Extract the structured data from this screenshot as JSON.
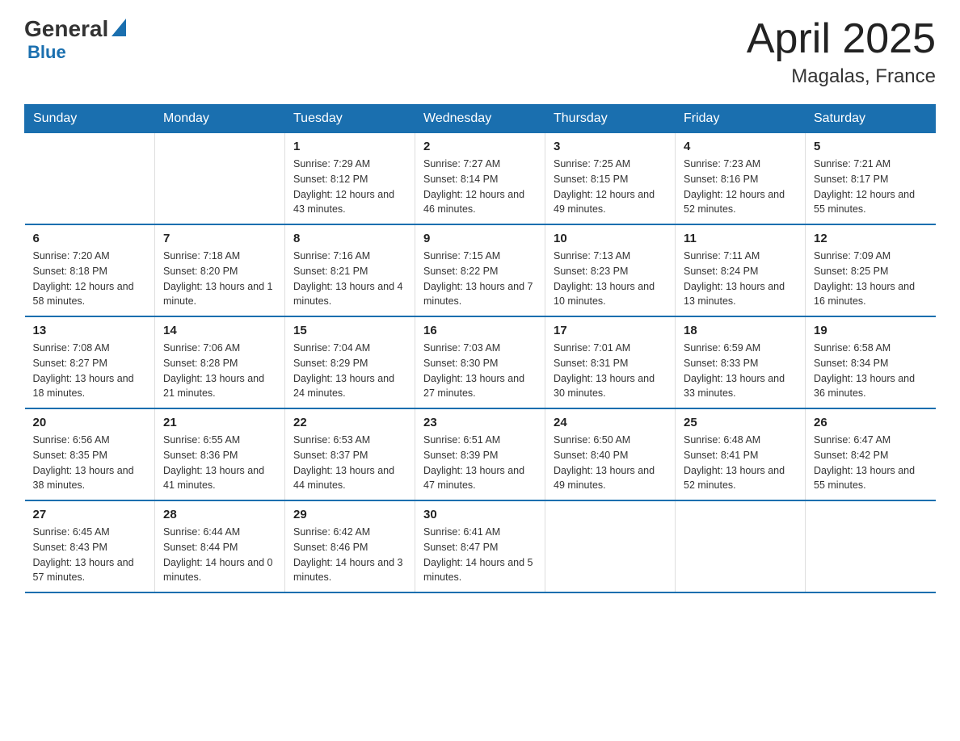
{
  "header": {
    "logo_general": "General",
    "logo_blue": "Blue",
    "month": "April 2025",
    "location": "Magalas, France"
  },
  "weekdays": [
    "Sunday",
    "Monday",
    "Tuesday",
    "Wednesday",
    "Thursday",
    "Friday",
    "Saturday"
  ],
  "weeks": [
    [
      {
        "day": "",
        "sunrise": "",
        "sunset": "",
        "daylight": ""
      },
      {
        "day": "",
        "sunrise": "",
        "sunset": "",
        "daylight": ""
      },
      {
        "day": "1",
        "sunrise": "Sunrise: 7:29 AM",
        "sunset": "Sunset: 8:12 PM",
        "daylight": "Daylight: 12 hours and 43 minutes."
      },
      {
        "day": "2",
        "sunrise": "Sunrise: 7:27 AM",
        "sunset": "Sunset: 8:14 PM",
        "daylight": "Daylight: 12 hours and 46 minutes."
      },
      {
        "day": "3",
        "sunrise": "Sunrise: 7:25 AM",
        "sunset": "Sunset: 8:15 PM",
        "daylight": "Daylight: 12 hours and 49 minutes."
      },
      {
        "day": "4",
        "sunrise": "Sunrise: 7:23 AM",
        "sunset": "Sunset: 8:16 PM",
        "daylight": "Daylight: 12 hours and 52 minutes."
      },
      {
        "day": "5",
        "sunrise": "Sunrise: 7:21 AM",
        "sunset": "Sunset: 8:17 PM",
        "daylight": "Daylight: 12 hours and 55 minutes."
      }
    ],
    [
      {
        "day": "6",
        "sunrise": "Sunrise: 7:20 AM",
        "sunset": "Sunset: 8:18 PM",
        "daylight": "Daylight: 12 hours and 58 minutes."
      },
      {
        "day": "7",
        "sunrise": "Sunrise: 7:18 AM",
        "sunset": "Sunset: 8:20 PM",
        "daylight": "Daylight: 13 hours and 1 minute."
      },
      {
        "day": "8",
        "sunrise": "Sunrise: 7:16 AM",
        "sunset": "Sunset: 8:21 PM",
        "daylight": "Daylight: 13 hours and 4 minutes."
      },
      {
        "day": "9",
        "sunrise": "Sunrise: 7:15 AM",
        "sunset": "Sunset: 8:22 PM",
        "daylight": "Daylight: 13 hours and 7 minutes."
      },
      {
        "day": "10",
        "sunrise": "Sunrise: 7:13 AM",
        "sunset": "Sunset: 8:23 PM",
        "daylight": "Daylight: 13 hours and 10 minutes."
      },
      {
        "day": "11",
        "sunrise": "Sunrise: 7:11 AM",
        "sunset": "Sunset: 8:24 PM",
        "daylight": "Daylight: 13 hours and 13 minutes."
      },
      {
        "day": "12",
        "sunrise": "Sunrise: 7:09 AM",
        "sunset": "Sunset: 8:25 PM",
        "daylight": "Daylight: 13 hours and 16 minutes."
      }
    ],
    [
      {
        "day": "13",
        "sunrise": "Sunrise: 7:08 AM",
        "sunset": "Sunset: 8:27 PM",
        "daylight": "Daylight: 13 hours and 18 minutes."
      },
      {
        "day": "14",
        "sunrise": "Sunrise: 7:06 AM",
        "sunset": "Sunset: 8:28 PM",
        "daylight": "Daylight: 13 hours and 21 minutes."
      },
      {
        "day": "15",
        "sunrise": "Sunrise: 7:04 AM",
        "sunset": "Sunset: 8:29 PM",
        "daylight": "Daylight: 13 hours and 24 minutes."
      },
      {
        "day": "16",
        "sunrise": "Sunrise: 7:03 AM",
        "sunset": "Sunset: 8:30 PM",
        "daylight": "Daylight: 13 hours and 27 minutes."
      },
      {
        "day": "17",
        "sunrise": "Sunrise: 7:01 AM",
        "sunset": "Sunset: 8:31 PM",
        "daylight": "Daylight: 13 hours and 30 minutes."
      },
      {
        "day": "18",
        "sunrise": "Sunrise: 6:59 AM",
        "sunset": "Sunset: 8:33 PM",
        "daylight": "Daylight: 13 hours and 33 minutes."
      },
      {
        "day": "19",
        "sunrise": "Sunrise: 6:58 AM",
        "sunset": "Sunset: 8:34 PM",
        "daylight": "Daylight: 13 hours and 36 minutes."
      }
    ],
    [
      {
        "day": "20",
        "sunrise": "Sunrise: 6:56 AM",
        "sunset": "Sunset: 8:35 PM",
        "daylight": "Daylight: 13 hours and 38 minutes."
      },
      {
        "day": "21",
        "sunrise": "Sunrise: 6:55 AM",
        "sunset": "Sunset: 8:36 PM",
        "daylight": "Daylight: 13 hours and 41 minutes."
      },
      {
        "day": "22",
        "sunrise": "Sunrise: 6:53 AM",
        "sunset": "Sunset: 8:37 PM",
        "daylight": "Daylight: 13 hours and 44 minutes."
      },
      {
        "day": "23",
        "sunrise": "Sunrise: 6:51 AM",
        "sunset": "Sunset: 8:39 PM",
        "daylight": "Daylight: 13 hours and 47 minutes."
      },
      {
        "day": "24",
        "sunrise": "Sunrise: 6:50 AM",
        "sunset": "Sunset: 8:40 PM",
        "daylight": "Daylight: 13 hours and 49 minutes."
      },
      {
        "day": "25",
        "sunrise": "Sunrise: 6:48 AM",
        "sunset": "Sunset: 8:41 PM",
        "daylight": "Daylight: 13 hours and 52 minutes."
      },
      {
        "day": "26",
        "sunrise": "Sunrise: 6:47 AM",
        "sunset": "Sunset: 8:42 PM",
        "daylight": "Daylight: 13 hours and 55 minutes."
      }
    ],
    [
      {
        "day": "27",
        "sunrise": "Sunrise: 6:45 AM",
        "sunset": "Sunset: 8:43 PM",
        "daylight": "Daylight: 13 hours and 57 minutes."
      },
      {
        "day": "28",
        "sunrise": "Sunrise: 6:44 AM",
        "sunset": "Sunset: 8:44 PM",
        "daylight": "Daylight: 14 hours and 0 minutes."
      },
      {
        "day": "29",
        "sunrise": "Sunrise: 6:42 AM",
        "sunset": "Sunset: 8:46 PM",
        "daylight": "Daylight: 14 hours and 3 minutes."
      },
      {
        "day": "30",
        "sunrise": "Sunrise: 6:41 AM",
        "sunset": "Sunset: 8:47 PM",
        "daylight": "Daylight: 14 hours and 5 minutes."
      },
      {
        "day": "",
        "sunrise": "",
        "sunset": "",
        "daylight": ""
      },
      {
        "day": "",
        "sunrise": "",
        "sunset": "",
        "daylight": ""
      },
      {
        "day": "",
        "sunrise": "",
        "sunset": "",
        "daylight": ""
      }
    ]
  ]
}
